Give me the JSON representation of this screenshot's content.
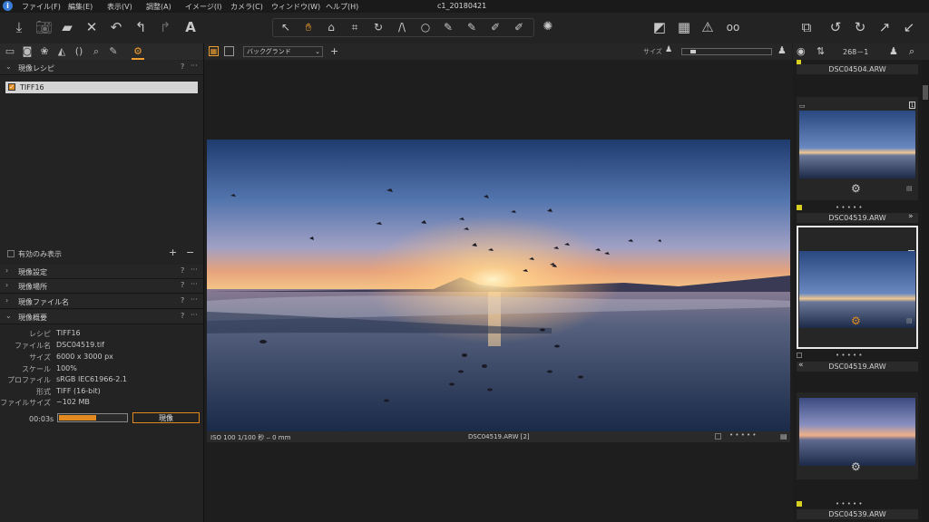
{
  "window": {
    "title": "c1_20180421",
    "menu": [
      "ファイル(F)",
      "編集(E)",
      "表示(V)",
      "調整(A)",
      "イメージ(I)",
      "カメラ(C)",
      "ウィンドウ(W)",
      "ヘルプ(H)"
    ]
  },
  "toolbar": {
    "left_icons": [
      "import-icon",
      "camera-icon",
      "folder-icon",
      "delete-icon",
      "undo-icon",
      "undo-step-icon",
      "redo-icon",
      "text-tool-icon"
    ],
    "cursor_tools": [
      "select-cursor-icon",
      "pan-hand-icon",
      "stamp-icon",
      "crop-icon",
      "rotate-icon",
      "keystone-icon",
      "spot-circle-icon",
      "brush-icon",
      "eraser-brush-icon",
      "fill-brush-icon",
      "gradient-brush-icon"
    ],
    "right_icons": [
      "before-after-icon",
      "grid-icon",
      "warning-icon",
      "glasses-icon",
      "copy-apply-icon",
      "rotate-left-icon",
      "rotate-right-icon",
      "copy-adjust-icon",
      "apply-adjust-icon"
    ]
  },
  "left_panel": {
    "recipe_section": {
      "title": "現像レシピ",
      "help": "?",
      "more": "···"
    },
    "recipe_item": "TIFF16",
    "enabled_only_label": "有効のみ表示",
    "collapsed_sections": [
      {
        "title": "現像設定"
      },
      {
        "title": "現像場所"
      },
      {
        "title": "現像ファイル名"
      }
    ],
    "summary_section": {
      "title": "現像概要"
    },
    "summary": [
      {
        "key": "レシピ",
        "value": "TIFF16"
      },
      {
        "key": "ファイル名",
        "value": "DSC04519.tif"
      },
      {
        "key": "サイズ",
        "value": "6000 x 3000 px"
      },
      {
        "key": "スケール",
        "value": "100%"
      },
      {
        "key": "プロファイル",
        "value": "sRGB IEC61966-2.1"
      },
      {
        "key": "形式",
        "value": "TIFF (16-bit)"
      },
      {
        "key": "ファイルサイズ",
        "value": "~102 MB"
      }
    ],
    "process_time": "00:03s",
    "process_progress": 0.55,
    "process_button": "現像"
  },
  "viewer": {
    "background_select": "バックグランド",
    "size_label": "サイズ",
    "size_level": 0.1,
    "info_left": "ISO 100  1/100 秒  ‒  0 mm",
    "info_center": "DSC04519.ARW [2]",
    "rating_dots": "• • • • •"
  },
  "browser": {
    "count": "268－1",
    "items": [
      {
        "name": "DSC04504.ARW"
      },
      {
        "name": "DSC04519.ARW",
        "badge": "1"
      },
      {
        "name": "DSC04519.ARW",
        "badge": "2"
      },
      {
        "name": "DSC04539.ARW"
      }
    ],
    "rating_dots": "• • • • •",
    "accent": "#e08a20",
    "color_tag": "#d8d020"
  }
}
